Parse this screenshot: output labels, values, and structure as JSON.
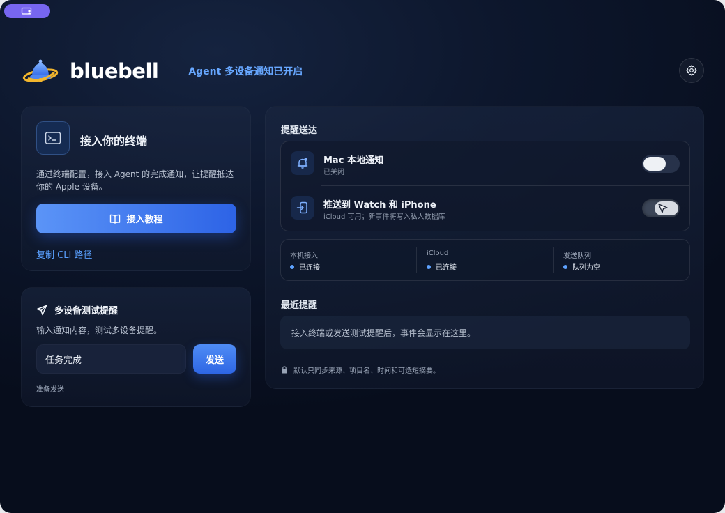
{
  "brand": {
    "name": "bluebell",
    "status": "Agent 多设备通知已开启"
  },
  "connect": {
    "title": "接入你的终端",
    "description": "通过终端配置，接入 Agent 的完成通知，让提醒抵达你的 Apple 设备。",
    "tutorial_button": "接入教程",
    "copy_cli_link": "复制 CLI 路径"
  },
  "test": {
    "title": "多设备测试提醒",
    "description": "输入通知内容，测试多设备提醒。",
    "input_value": "任务完成",
    "send_button": "发送",
    "status": "准备发送"
  },
  "delivery": {
    "title": "提醒送达",
    "channels": [
      {
        "title": "Mac 本地通知",
        "subtitle": "已关闭",
        "icon": "bell-icon",
        "enabled": false
      },
      {
        "title": "推送到 Watch 和 iPhone",
        "subtitle": "iCloud 可用；新事件将写入私人数据库",
        "icon": "device-push-icon",
        "enabled": true
      }
    ],
    "status_items": [
      {
        "label": "本机接入",
        "value": "已连接"
      },
      {
        "label": "iCloud",
        "value": "已连接"
      },
      {
        "label": "发送队列",
        "value": "队列为空"
      }
    ]
  },
  "recent": {
    "title": "最近提醒",
    "empty_text": "接入终端或发送测试提醒后，事件会显示在这里。",
    "privacy_note": "默认只同步来源、项目名、时间和可选短摘要。"
  },
  "colors": {
    "accent": "#3a72ea",
    "link": "#5aa0ff",
    "status_text": "#67a7ff",
    "window_pill": "#7766f0"
  }
}
